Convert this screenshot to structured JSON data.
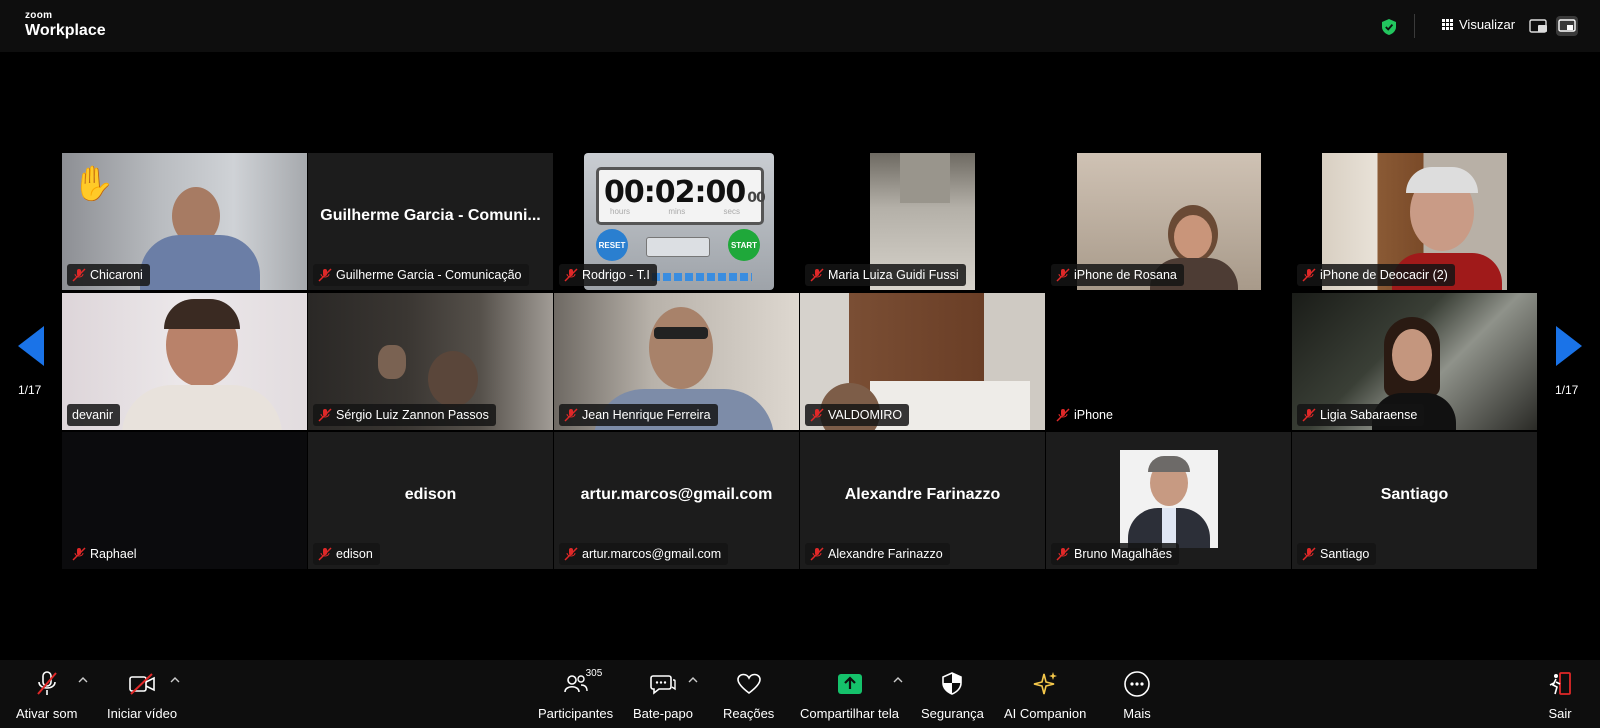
{
  "app": {
    "logo_small": "zoom",
    "logo_big": "Workplace"
  },
  "topbar": {
    "view_label": "Visualizar"
  },
  "pager": {
    "left": "1/17",
    "right": "1/17"
  },
  "tiles": [
    {
      "name": "Chicaroni",
      "muted": true,
      "center": ""
    },
    {
      "name": "Guilherme Garcia - Comunicação",
      "muted": true,
      "center": "Guilherme Garcia - Comuni..."
    },
    {
      "name": "Rodrigo - T.I",
      "muted": true,
      "center": ""
    },
    {
      "name": "Maria Luiza Guidi Fussi",
      "muted": true,
      "center": ""
    },
    {
      "name": "iPhone de Rosana",
      "muted": true,
      "center": ""
    },
    {
      "name": "iPhone de Deocacir (2)",
      "muted": true,
      "center": ""
    },
    {
      "name": "devanir",
      "muted": false,
      "center": ""
    },
    {
      "name": "Sérgio Luiz Zannon Passos",
      "muted": true,
      "center": ""
    },
    {
      "name": "Jean Henrique Ferreira",
      "muted": true,
      "center": ""
    },
    {
      "name": "VALDOMIRO",
      "muted": true,
      "center": ""
    },
    {
      "name": "iPhone",
      "muted": true,
      "center": ""
    },
    {
      "name": "Ligia Sabaraense",
      "muted": true,
      "center": ""
    },
    {
      "name": "Raphael",
      "muted": true,
      "center": ""
    },
    {
      "name": "edison",
      "muted": true,
      "center": "edison"
    },
    {
      "name": "artur.marcos@gmail.com",
      "muted": true,
      "center": "artur.marcos@gmail.com"
    },
    {
      "name": "Alexandre Farinazzo",
      "muted": true,
      "center": "Alexandre Farinazzo"
    },
    {
      "name": "Bruno Magalhães",
      "muted": true,
      "center": ""
    },
    {
      "name": "Santiago",
      "muted": true,
      "center": "Santiago"
    }
  ],
  "timer": {
    "display": "00:02:00",
    "hundredths": "00",
    "units": [
      "hours",
      "mins",
      "secs"
    ],
    "reset": "RESET",
    "start": "START"
  },
  "toolbar": {
    "audio": "Ativar som",
    "video": "Iniciar vídeo",
    "participants": "Participantes",
    "participants_count": "305",
    "chat": "Bate-papo",
    "reactions": "Reações",
    "share": "Compartilhar tela",
    "security": "Segurança",
    "ai": "AI Companion",
    "more": "Mais",
    "leave": "Sair"
  },
  "colors": {
    "accent_green": "#22c55e",
    "share_green": "#15c26b",
    "nav_blue": "#1a73e8",
    "active_border": "#d6e05a",
    "mute_red": "#e02828"
  }
}
